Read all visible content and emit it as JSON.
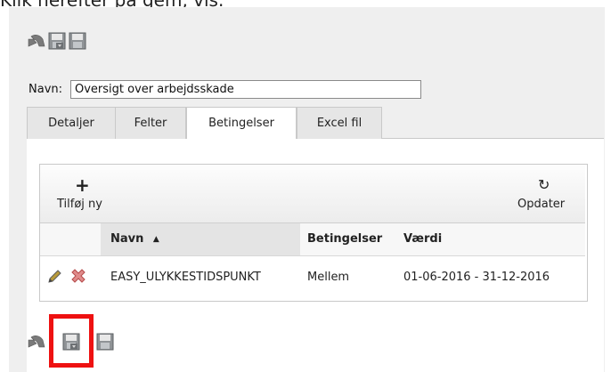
{
  "instruction_text": "Klik herefter på gem, vis.",
  "top_toolbar": {
    "icons": [
      "undo-icon",
      "save-view-icon",
      "save-icon"
    ]
  },
  "name_field": {
    "label": "Navn:",
    "value": "Oversigt over arbejdsskade"
  },
  "tabs": [
    {
      "label": "Detaljer",
      "active": false
    },
    {
      "label": "Felter",
      "active": false
    },
    {
      "label": "Betingelser",
      "active": true
    },
    {
      "label": "Excel fil",
      "active": false
    }
  ],
  "grid_toolbar": {
    "add_symbol": "+",
    "add_label": "Tilføj ny",
    "refresh_symbol": "↻",
    "refresh_label": "Opdater"
  },
  "table": {
    "columns": [
      "Navn",
      "Betingelser",
      "Værdi"
    ],
    "sort_indicator": "▲",
    "rows": [
      {
        "name": "EASY_ULYKKESTIDSPUNKT",
        "condition": "Mellem",
        "value": "01-06-2016 - 31-12-2016"
      }
    ]
  },
  "bottom_toolbar": {
    "icons": [
      "undo-icon",
      "save-view-icon",
      "save-icon"
    ],
    "highlighted": "save-view-icon"
  },
  "colors": {
    "highlight_border": "#ee1111",
    "panel_bg": "#efefef"
  }
}
